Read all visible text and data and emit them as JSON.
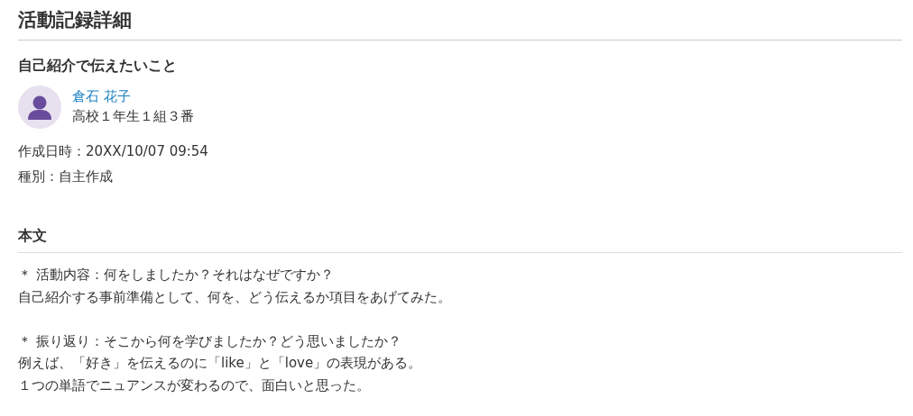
{
  "page_title": "活動記録詳細",
  "record": {
    "title": "自己紹介で伝えたいこと",
    "author": {
      "name": "倉石 花子",
      "affiliation": "高校１年生１組３番"
    },
    "meta": [
      "作成日時：20XX/10/07 09:54",
      "種別：自主作成"
    ]
  },
  "body": {
    "heading": "本文",
    "paragraphs": [
      [
        "＊ 活動内容：何をしましたか？それはなぜですか？",
        "自己紹介する事前準備として、何を、どう伝えるか項目をあげてみた。"
      ],
      [
        "＊ 振り返り：そこから何を学びましたか？どう思いましたか？",
        "例えば、「好き」を伝えるのに「like」と「love」の表現がある。",
        "１つの単語でニュアンスが変わるので、面白いと思った。"
      ]
    ]
  }
}
